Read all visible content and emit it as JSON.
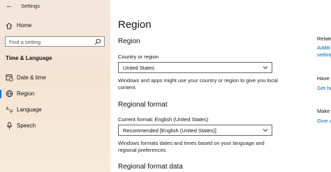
{
  "titlebar": {
    "title": "Settings"
  },
  "sidebar": {
    "home": "Home",
    "search_placeholder": "Find a setting",
    "section": "Time & Language",
    "items": [
      {
        "label": "Date & time",
        "icon": "calendar-clock-icon"
      },
      {
        "label": "Region",
        "icon": "globe-icon",
        "selected": true
      },
      {
        "label": "Language",
        "icon": "language-icon"
      },
      {
        "label": "Speech",
        "icon": "microphone-icon"
      }
    ]
  },
  "main": {
    "title": "Region",
    "region_heading": "Region",
    "country_label": "Country or region",
    "country_value": "United States",
    "country_desc": "Windows and apps might use your country or region to give you local content.",
    "format_heading": "Regional format",
    "current_format": "Current format: English (United States)",
    "format_value": "Recommended [English (United States)]",
    "format_desc": "Windows formats dates and times based on your language and regional preferences.",
    "format_data_heading": "Regional format data"
  },
  "right": {
    "related_heading": "Relate",
    "related_link1": "Additi",
    "related_link2": "setting",
    "have_heading": "Have a",
    "have_link": "Get he",
    "make_heading": "Make",
    "make_link": "Give u"
  },
  "colors": {
    "accent": "#0078d7",
    "link": "#0067b8"
  }
}
